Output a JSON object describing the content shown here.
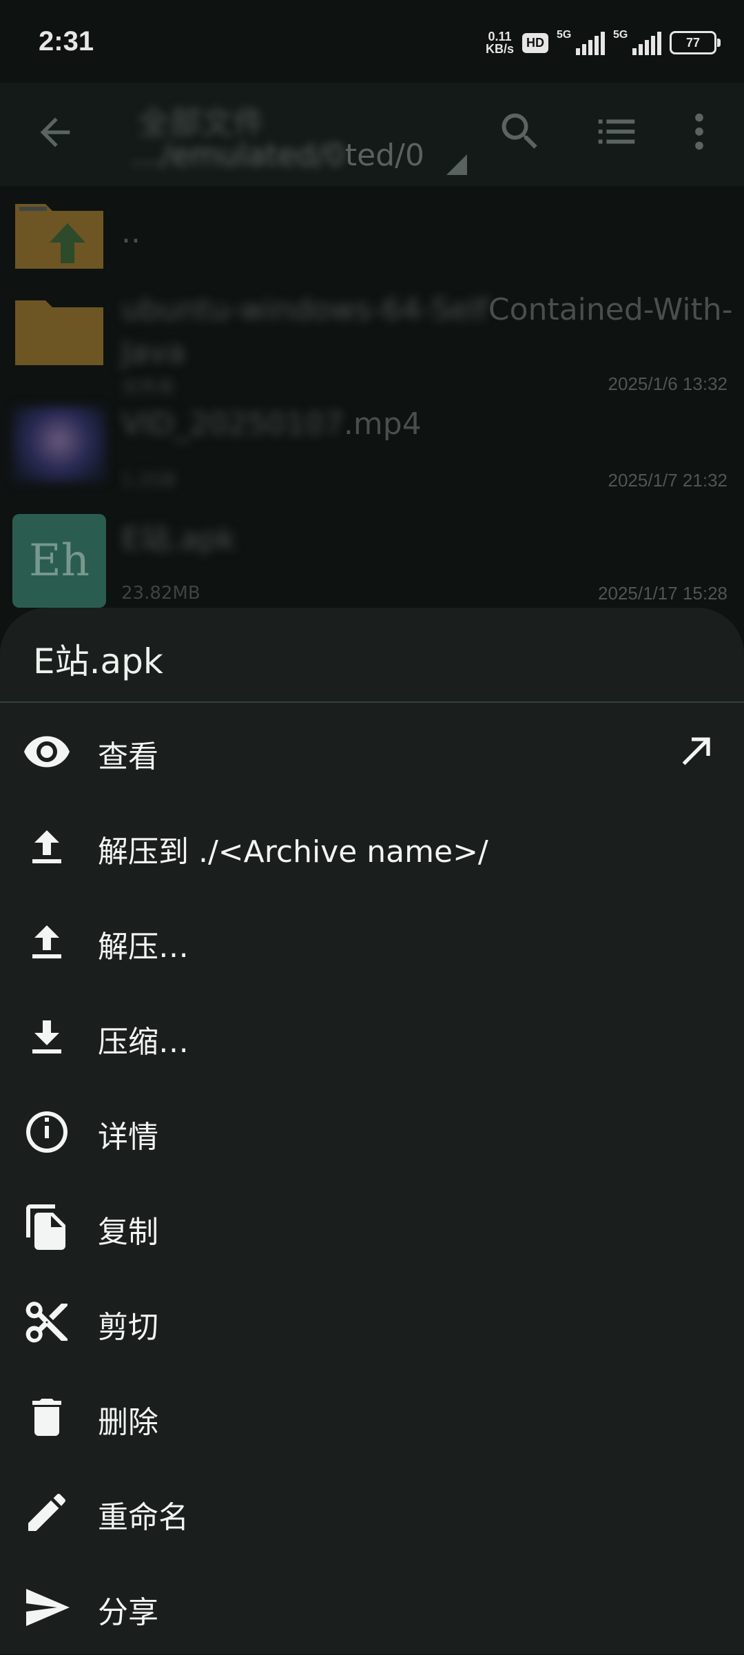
{
  "status_bar": {
    "time": "2:31",
    "net_speed_value": "0.11",
    "net_speed_unit": "KB/s",
    "hd_badge": "HD",
    "signal1_label": "5G",
    "signal2_label": "5G",
    "battery": "77"
  },
  "toolbar": {
    "title": "全部文件",
    "subtitle_visible": "ted/0",
    "subtitle_blurred": "…/emulated/0"
  },
  "files": [
    {
      "name": "..",
      "meta": "",
      "date": ""
    },
    {
      "name_blurred": "ubuntu-windows-64-Self",
      "name_visible": "Contained-With-",
      "name_line2": "Java",
      "meta": "文件夹",
      "date": "2025/1/6 13:32"
    },
    {
      "name_blurred": "VID_20250107",
      "name_visible": ".mp4",
      "meta": "1.2GB",
      "date": "2025/1/7 21:32"
    },
    {
      "name": "E站.apk",
      "meta_visible": "23.82MB",
      "date": "2025/1/17 15:28",
      "thumb_text": "Eh"
    }
  ],
  "sheet": {
    "title": "E站.apk",
    "items": [
      {
        "label": "查看",
        "icon": "eye-icon"
      },
      {
        "label": "解压到 ./<Archive name>/",
        "icon": "upload-icon"
      },
      {
        "label": "解压…",
        "icon": "upload-icon"
      },
      {
        "label": "压缩…",
        "icon": "download-icon"
      },
      {
        "label": "详情",
        "icon": "info-icon"
      },
      {
        "label": "复制",
        "icon": "copy-icon"
      },
      {
        "label": "剪切",
        "icon": "scissors-icon"
      },
      {
        "label": "删除",
        "icon": "trash-icon"
      },
      {
        "label": "重命名",
        "icon": "pencil-icon"
      },
      {
        "label": "分享",
        "icon": "send-icon"
      }
    ]
  },
  "colors": {
    "background": "#0e1211",
    "sheet": "#1a1f1d",
    "toolbar": "#141a18",
    "folder": "#8a6a2a",
    "apk_thumb": "#2f6b5a",
    "text_primary": "#f2f5f3"
  }
}
